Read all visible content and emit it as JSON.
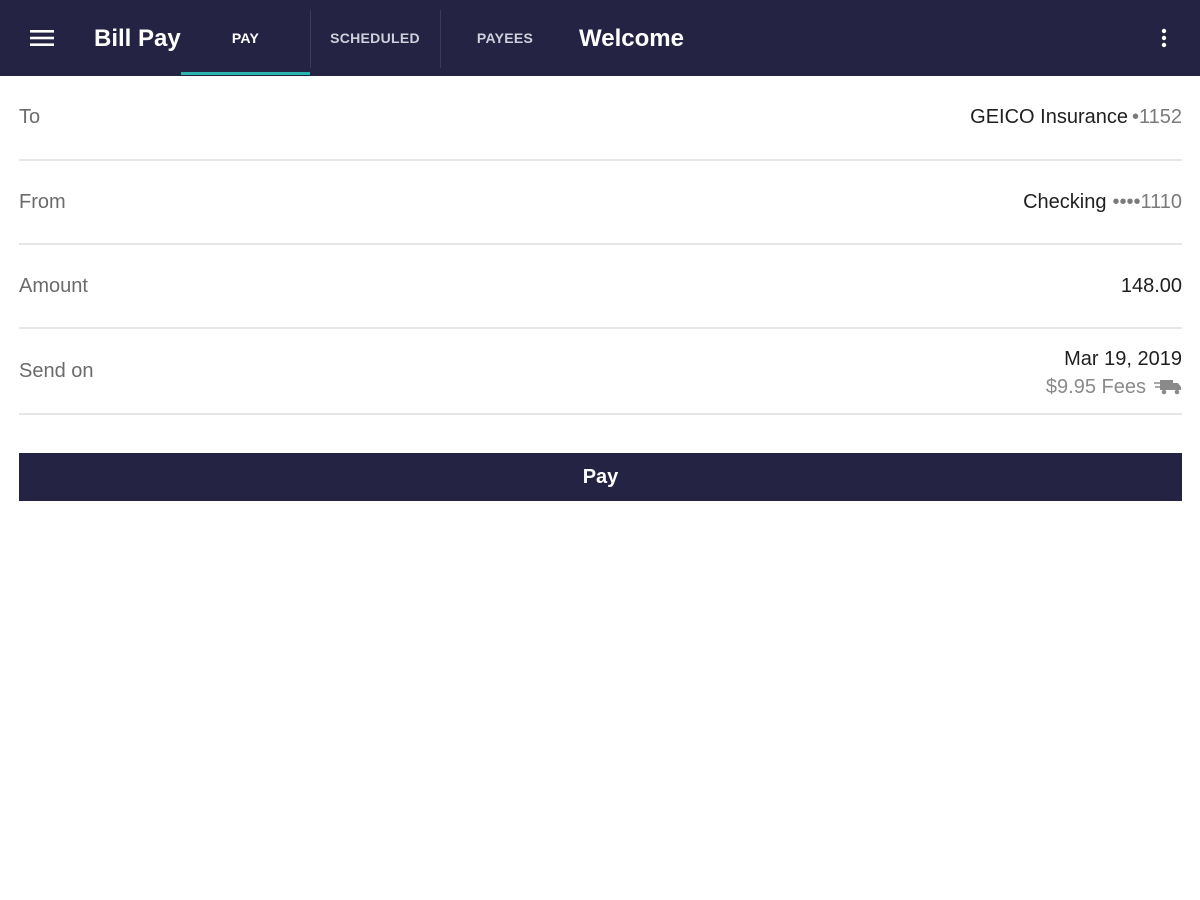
{
  "appbar": {
    "menu_icon": "hamburger-menu-icon",
    "title": "Bill Pay",
    "tabs": [
      {
        "label": "PAY",
        "active": true
      },
      {
        "label": "SCHEDULED",
        "active": false
      },
      {
        "label": "PAYEES",
        "active": false
      }
    ],
    "welcome": "Welcome",
    "overflow_icon": "more-vertical-icon",
    "background_color": "#252344",
    "indicator_color": "#2bb4ad"
  },
  "form": {
    "to": {
      "label": "To",
      "payee": "GEICO Insurance",
      "account_mask": "•1152"
    },
    "from": {
      "label": "From",
      "account": "Checking",
      "account_mask": "••••1110"
    },
    "amount": {
      "label": "Amount",
      "value": "148.00"
    },
    "send_on": {
      "label": "Send on",
      "date": "Mar 19, 2019",
      "fees": "$9.95 Fees",
      "fees_icon": "delivery-truck-icon"
    }
  },
  "pay_button": {
    "label": "Pay",
    "color": "#252344"
  }
}
